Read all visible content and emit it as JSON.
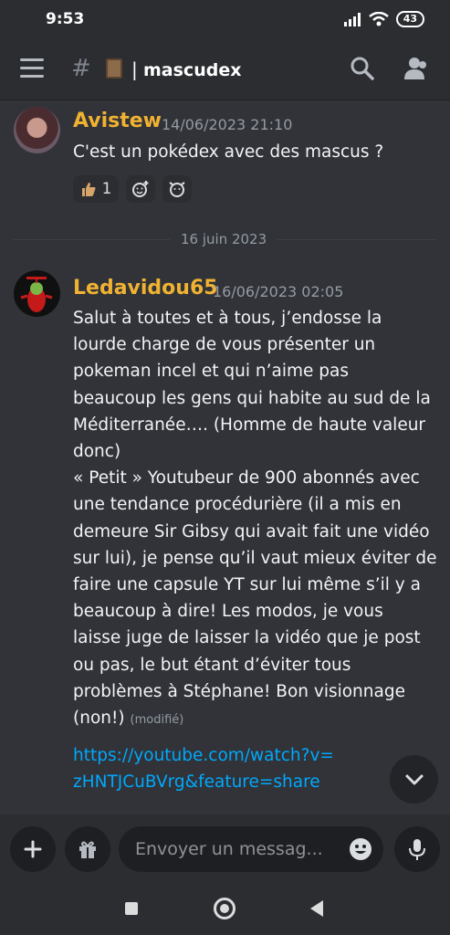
{
  "status_bar": {
    "time": "9:53",
    "battery": "43"
  },
  "header": {
    "channel_name": "mascudex",
    "hash": "#",
    "separator": "|"
  },
  "messages": [
    {
      "author": "Avistew",
      "timestamp": "14/06/2023 21:10",
      "text": "C'est un pokédex avec des mascus ?",
      "reactions": [
        {
          "emoji": "thumbs-up-icon",
          "count": "1"
        },
        {
          "emoji": "add-reaction-icon"
        },
        {
          "emoji": "add-super-reaction-icon"
        }
      ]
    },
    {
      "author": "Ledavidou65",
      "timestamp": "16/06/2023 02:05",
      "text_lines": [
        "Salut à toutes et à tous, j’endosse la",
        "lourde charge de vous présenter un",
        "pokeman incel et qui n’aime pas",
        "beaucoup les gens qui habite au sud de la",
        "Méditerranée…. (Homme de haute valeur",
        "donc)",
        "« Petit » Youtubeur de 900 abonnés avec",
        "une tendance procédurière (il a mis en",
        "demeure Sir Gibsy qui avait fait une vidéo",
        "sur lui), je pense qu’il vaut mieux éviter de",
        "faire une capsule YT sur lui même s’il y a",
        "beaucoup à dire! Les modos, je vous",
        "laisse juge de laisser la vidéo que je post",
        "ou pas, le but étant d’éviter tous",
        "problèmes à Stéphane! Bon visionnage",
        "(non!)"
      ],
      "edited": "(modifié)",
      "link_lines": [
        "https://youtube.com/watch?v=",
        "zHNTJCuBVrg&feature=share"
      ]
    }
  ],
  "date_divider": "16 juin 2023",
  "composer": {
    "placeholder": "Envoyer un messag..."
  },
  "colors": {
    "author": "#f0b232",
    "link": "#00a8fc",
    "background": "#313338"
  }
}
